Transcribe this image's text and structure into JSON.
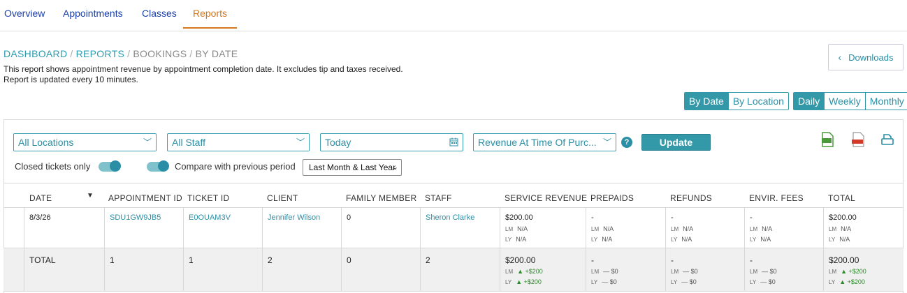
{
  "tabs": [
    {
      "label": "Overview"
    },
    {
      "label": "Appointments"
    },
    {
      "label": "Classes"
    },
    {
      "label": "Reports"
    }
  ],
  "breadcrumb": {
    "dashboard": "DASHBOARD",
    "reports": "REPORTS",
    "bookings": "BOOKINGS",
    "current": "BY DATE",
    "separator": "/"
  },
  "description": {
    "line1": "This report shows appointment revenue by appointment completion date. It excludes tip and taxes received.",
    "line2": "Report is updated every 10 minutes."
  },
  "downloads_label": "Downloads",
  "view_toggle": {
    "by_date": "By Date",
    "by_location": "By Location"
  },
  "period_toggle": {
    "daily": "Daily",
    "weekly": "Weekly",
    "monthly": "Monthly"
  },
  "filters": {
    "location": "All Locations",
    "staff": "All Staff",
    "date": "Today",
    "revenue_type": "Revenue At Time Of Purc...",
    "help": "?",
    "update_label": "Update",
    "closed_tickets_label": "Closed tickets only",
    "compare_label": "Compare with previous period",
    "compare_option": "Last Month & Last Year"
  },
  "table": {
    "headers": {
      "date": "DATE",
      "appointment_id": "APPOINTMENT ID",
      "ticket_id": "TICKET ID",
      "client": "CLIENT",
      "family_member": "FAMILY MEMBER",
      "staff": "STAFF",
      "service_revenue": "SERVICE REVENUE",
      "prepaids": "PREPAIDS",
      "refunds": "REFUNDS",
      "envir_fees": "ENVIR. FEES",
      "total": "TOTAL"
    },
    "sub_labels": {
      "lm": "LM",
      "ly": "LY"
    },
    "row": {
      "date": "8/3/26",
      "appointment_id": "SDU1GW9JB5",
      "ticket_id": "E0OUAM3V",
      "client": "Jennifer Wilson",
      "family_member": "0",
      "staff": "Sheron Clarke",
      "service_revenue": "$200.00",
      "prepaids": "-",
      "refunds": "-",
      "envir_fees": "-",
      "total": "$200.00",
      "na": "N/A"
    },
    "total_row": {
      "label": "TOTAL",
      "appointment_id": "1",
      "ticket_id": "1",
      "client": "2",
      "family_member": "0",
      "staff": "2",
      "service_revenue": "$200.00",
      "prepaids": "-",
      "refunds": "-",
      "envir_fees": "-",
      "total": "$200.00",
      "delta_up": "▲ +$200",
      "delta_zero": "— $0"
    }
  }
}
